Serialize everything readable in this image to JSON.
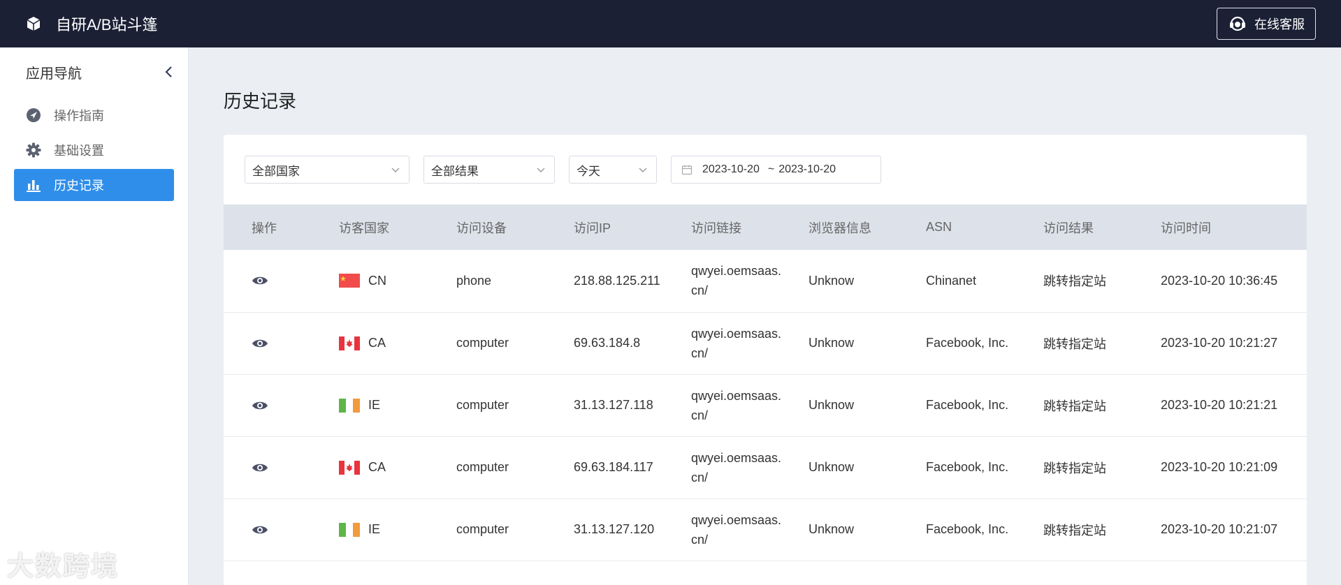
{
  "header": {
    "app_title": "自研A/B站斗篷",
    "support_label": "在线客服"
  },
  "sidebar": {
    "title": "应用导航",
    "items": [
      {
        "label": "操作指南",
        "icon": "compass-icon"
      },
      {
        "label": "基础设置",
        "icon": "gear-icon"
      },
      {
        "label": "历史记录",
        "icon": "bar-chart-icon",
        "active": true
      }
    ]
  },
  "page": {
    "title": "历史记录"
  },
  "filters": {
    "country": "全部国家",
    "result": "全部结果",
    "period": "今天",
    "date_start": "2023-10-20",
    "date_sep": "~",
    "date_end": "2023-10-20"
  },
  "table": {
    "headers": [
      "操作",
      "访客国家",
      "访问设备",
      "访问IP",
      "访问链接",
      "浏览器信息",
      "ASN",
      "访问结果",
      "访问时间"
    ],
    "rows": [
      {
        "country": "CN",
        "device": "phone",
        "ip": "218.88.125.211",
        "link1": "qwyei.oemsaas.",
        "link2": "cn/",
        "browser": "Unknow",
        "asn": "Chinanet",
        "result": "跳转指定站",
        "time": "2023-10-20 10:36:45"
      },
      {
        "country": "CA",
        "device": "computer",
        "ip": "69.63.184.8",
        "link1": "qwyei.oemsaas.",
        "link2": "cn/",
        "browser": "Unknow",
        "asn": "Facebook, Inc.",
        "result": "跳转指定站",
        "time": "2023-10-20 10:21:27"
      },
      {
        "country": "IE",
        "device": "computer",
        "ip": "31.13.127.118",
        "link1": "qwyei.oemsaas.",
        "link2": "cn/",
        "browser": "Unknow",
        "asn": "Facebook, Inc.",
        "result": "跳转指定站",
        "time": "2023-10-20 10:21:21"
      },
      {
        "country": "CA",
        "device": "computer",
        "ip": "69.63.184.117",
        "link1": "qwyei.oemsaas.",
        "link2": "cn/",
        "browser": "Unknow",
        "asn": "Facebook, Inc.",
        "result": "跳转指定站",
        "time": "2023-10-20 10:21:09"
      },
      {
        "country": "IE",
        "device": "computer",
        "ip": "31.13.127.120",
        "link1": "qwyei.oemsaas.",
        "link2": "cn/",
        "browser": "Unknow",
        "asn": "Facebook, Inc.",
        "result": "跳转指定站",
        "time": "2023-10-20 10:21:07"
      }
    ]
  },
  "watermark": "大数跨境",
  "colors": {
    "topbar": "#1b2035",
    "accent": "#2f8ee9",
    "table_header": "#dde2ea",
    "page_bg": "#ebeef3"
  }
}
